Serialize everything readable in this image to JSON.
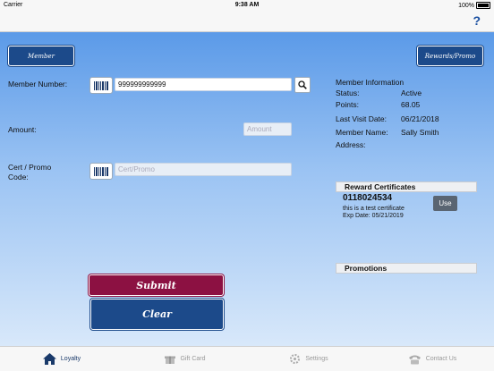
{
  "status_bar": {
    "carrier": "Carrier",
    "time": "9:38 AM",
    "battery": "100%"
  },
  "nav": {
    "help": "?"
  },
  "buttons": {
    "member": "Member",
    "rewards_promo": "Rewards/Promo",
    "submit": "Submit",
    "clear": "Clear",
    "use": "Use"
  },
  "form": {
    "member_number_label": "Member Number:",
    "member_number_value": "999999999999",
    "amount_label": "Amount:",
    "amount_placeholder": "Amount",
    "cert_label_line1": "Cert / Promo",
    "cert_label_line2": "Code:",
    "cert_placeholder": "Cert/Promo"
  },
  "member_info": {
    "title": "Member Information",
    "rows": [
      {
        "label": "Status:",
        "value": "Active"
      },
      {
        "label": "Points:",
        "value": "68.05"
      },
      {
        "label": "Last Visit Date:",
        "value": "06/21/2018"
      },
      {
        "label": "Member Name:",
        "value": "Sally Smith"
      },
      {
        "label": "Address:",
        "value": ""
      }
    ]
  },
  "reward_certificates": {
    "header": "Reward Certificates",
    "certificate": {
      "number": "0118024534",
      "description": "this is a test certificate",
      "expiry": "Exp Date: 05/21/2019"
    }
  },
  "promotions": {
    "header": "Promotions"
  },
  "tabs": [
    {
      "label": "Loyalty",
      "icon": "home-icon"
    },
    {
      "label": "Gift Card",
      "icon": "gift-icon"
    },
    {
      "label": "Settings",
      "icon": "gear-icon"
    },
    {
      "label": "Contact Us",
      "icon": "phone-icon"
    }
  ],
  "colors": {
    "primary": "#1c4a8a",
    "submit": "#8c1142",
    "background_top": "#5b9ae8"
  }
}
